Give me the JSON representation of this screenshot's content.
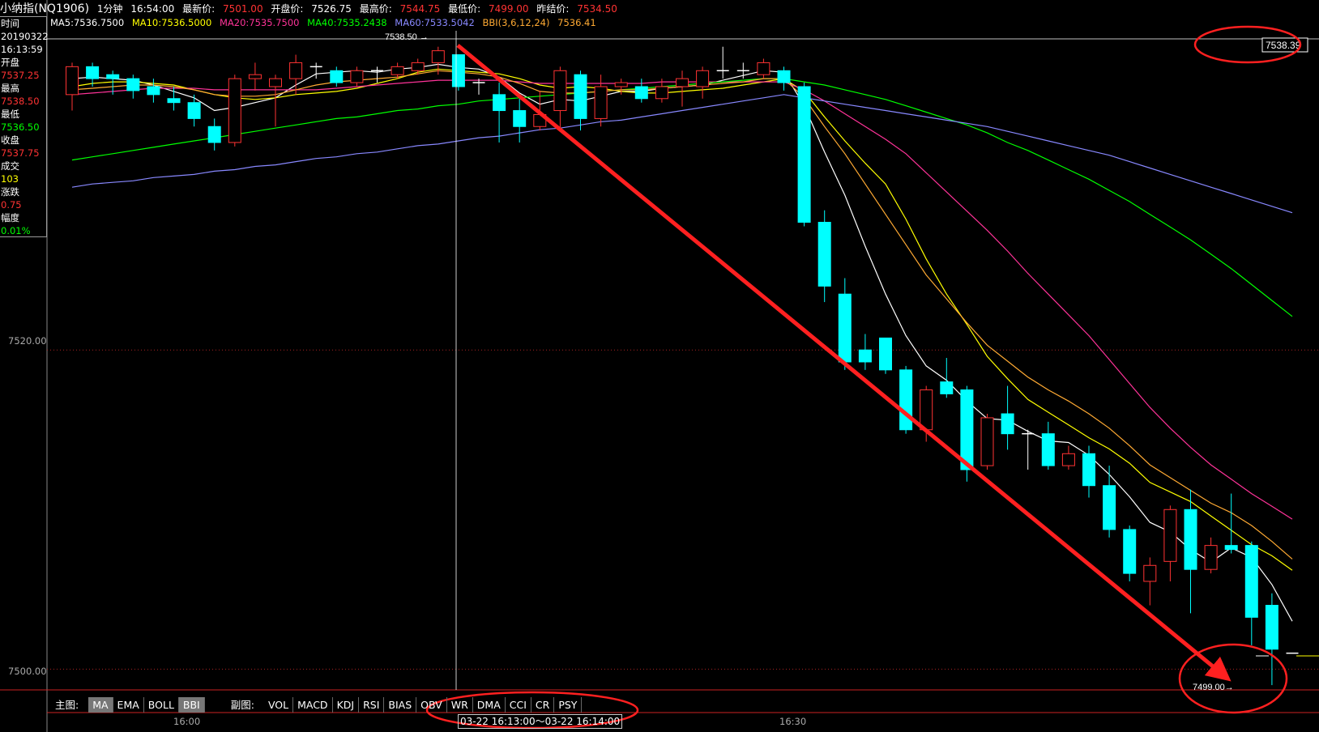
{
  "header": {
    "instrument": "小纳指(NQ1906)",
    "period": "1分钟",
    "time": "16:54:00",
    "latest_label": "最新价:",
    "latest": "7501.00",
    "open_label": "开盘价:",
    "open": "7526.75",
    "high_label": "最高价:",
    "high": "7544.75",
    "low_label": "最低价:",
    "low": "7499.00",
    "prev_close_label": "昨结价:",
    "prev_close": "7534.50"
  },
  "ma_legend": {
    "ma5": "MA5:7536.7500",
    "ma10": "MA10:7536.5000",
    "ma20": "MA20:7535.7500",
    "ma40": "MA40:7535.2438",
    "ma60": "MA60:7533.5042",
    "bbi": "BBI(3,6,12,24)",
    "bbi_val": "7536.41"
  },
  "info_panel": {
    "time_label": "时间",
    "date": "20190322",
    "time": "16:13:59",
    "open_label": "开盘",
    "open": "7537.25",
    "high_label": "最高",
    "high": "7538.50",
    "low_label": "最低",
    "low": "7536.50",
    "close_label": "收盘",
    "close": "7537.75",
    "volume_label": "成交",
    "volume": "103",
    "change_label": "涨跌",
    "change": "0.75",
    "amp_label": "幅度",
    "amp": "0.01%"
  },
  "annotations": {
    "cursor_high": "7538.50",
    "cursor_price": "7538.39",
    "low_mark": "7499.00"
  },
  "tabs": {
    "main_label": "主图:",
    "main": [
      "MA",
      "EMA",
      "BOLL",
      "BBI"
    ],
    "main_active": [
      "MA",
      "BBI"
    ],
    "sub_label": "副图:",
    "sub": [
      "VOL",
      "MACD",
      "KDJ",
      "RSI",
      "BIAS",
      "OBV",
      "WR",
      "DMA",
      "CCI",
      "CR",
      "PSY"
    ]
  },
  "time_axis": {
    "ticks": [
      "16:00",
      "16:30"
    ],
    "range": "03-22 16:13:00〜03-22 16:14:00"
  },
  "colors": {
    "up": "#ff3333",
    "down": "#00ffff",
    "ma5": "#ffffff",
    "ma10": "#ffff00",
    "ma20": "#ff3399",
    "ma40": "#00ff00",
    "ma60": "#8888ff",
    "bbi": "#ffaa33",
    "annotation": "#ff2020"
  },
  "chart_data": {
    "type": "candlestick",
    "y_ticks": [
      "7520.00",
      "7500.00"
    ],
    "ylim": [
      7498.7,
      7540.0
    ],
    "candles": [
      {
        "o": 7536.0,
        "c": 7537.75,
        "h": 7538.0,
        "l": 7535.0
      },
      {
        "o": 7537.75,
        "c": 7537.0,
        "h": 7538.0,
        "l": 7536.5
      },
      {
        "o": 7537.25,
        "c": 7537.0,
        "h": 7537.5,
        "l": 7536.0
      },
      {
        "o": 7537.0,
        "c": 7536.25,
        "h": 7537.25,
        "l": 7535.75
      },
      {
        "o": 7536.5,
        "c": 7536.0,
        "h": 7537.0,
        "l": 7535.5
      },
      {
        "o": 7535.75,
        "c": 7535.5,
        "h": 7536.5,
        "l": 7535.0
      },
      {
        "o": 7535.5,
        "c": 7534.5,
        "h": 7536.0,
        "l": 7534.0
      },
      {
        "o": 7534.0,
        "c": 7533.0,
        "h": 7534.5,
        "l": 7532.5
      },
      {
        "o": 7533.0,
        "c": 7537.0,
        "h": 7537.25,
        "l": 7532.75
      },
      {
        "o": 7537.0,
        "c": 7537.25,
        "h": 7538.0,
        "l": 7536.25
      },
      {
        "o": 7536.5,
        "c": 7537.0,
        "h": 7537.25,
        "l": 7534.0
      },
      {
        "o": 7537.0,
        "c": 7538.0,
        "h": 7538.5,
        "l": 7536.0
      },
      {
        "o": 7537.75,
        "c": 7537.75,
        "h": 7538.0,
        "l": 7537.0
      },
      {
        "o": 7537.5,
        "c": 7536.75,
        "h": 7537.75,
        "l": 7536.5
      },
      {
        "o": 7536.75,
        "c": 7537.5,
        "h": 7537.75,
        "l": 7536.5
      },
      {
        "o": 7537.5,
        "c": 7537.5,
        "h": 7537.75,
        "l": 7536.75
      },
      {
        "o": 7537.25,
        "c": 7537.75,
        "h": 7538.0,
        "l": 7537.0
      },
      {
        "o": 7537.5,
        "c": 7538.0,
        "h": 7538.25,
        "l": 7537.25
      },
      {
        "o": 7538.0,
        "c": 7538.75,
        "h": 7539.0,
        "l": 7537.25
      },
      {
        "o": 7538.5,
        "c": 7536.5,
        "h": 7538.5,
        "l": 7536.25
      },
      {
        "o": 7536.75,
        "c": 7536.75,
        "h": 7537.0,
        "l": 7536.0
      },
      {
        "o": 7536.0,
        "c": 7535.0,
        "h": 7536.75,
        "l": 7533.0
      },
      {
        "o": 7535.0,
        "c": 7534.0,
        "h": 7535.75,
        "l": 7533.0
      },
      {
        "o": 7534.0,
        "c": 7534.75,
        "h": 7536.25,
        "l": 7533.75
      },
      {
        "o": 7535.0,
        "c": 7537.5,
        "h": 7537.75,
        "l": 7533.75
      },
      {
        "o": 7537.25,
        "c": 7534.5,
        "h": 7537.5,
        "l": 7533.75
      },
      {
        "o": 7534.5,
        "c": 7536.5,
        "h": 7537.25,
        "l": 7534.0
      },
      {
        "o": 7536.5,
        "c": 7536.75,
        "h": 7537.0,
        "l": 7536.0
      },
      {
        "o": 7536.5,
        "c": 7535.75,
        "h": 7537.0,
        "l": 7535.5
      },
      {
        "o": 7535.75,
        "c": 7536.5,
        "h": 7537.0,
        "l": 7535.5
      },
      {
        "o": 7536.5,
        "c": 7537.0,
        "h": 7537.5,
        "l": 7535.25
      },
      {
        "o": 7536.5,
        "c": 7537.5,
        "h": 7537.75,
        "l": 7535.75
      },
      {
        "o": 7537.5,
        "c": 7537.5,
        "h": 7539.0,
        "l": 7537.0
      },
      {
        "o": 7537.5,
        "c": 7537.5,
        "h": 7538.0,
        "l": 7537.0
      },
      {
        "o": 7537.25,
        "c": 7538.0,
        "h": 7538.25,
        "l": 7537.0
      },
      {
        "o": 7537.5,
        "c": 7536.75,
        "h": 7537.75,
        "l": 7536.25
      },
      {
        "o": 7536.5,
        "c": 7528.0,
        "h": 7536.75,
        "l": 7527.75
      },
      {
        "o": 7528.0,
        "c": 7524.0,
        "h": 7528.75,
        "l": 7523.0
      },
      {
        "o": 7523.5,
        "c": 7519.25,
        "h": 7524.5,
        "l": 7518.75
      },
      {
        "o": 7520.0,
        "c": 7519.25,
        "h": 7521.0,
        "l": 7518.75
      },
      {
        "o": 7520.75,
        "c": 7518.75,
        "h": 7520.75,
        "l": 7518.5
      },
      {
        "o": 7518.75,
        "c": 7515.0,
        "h": 7519.0,
        "l": 7514.75
      },
      {
        "o": 7515.0,
        "c": 7517.5,
        "h": 7517.75,
        "l": 7514.25
      },
      {
        "o": 7518.0,
        "c": 7517.25,
        "h": 7519.5,
        "l": 7517.0
      },
      {
        "o": 7517.5,
        "c": 7512.5,
        "h": 7517.75,
        "l": 7511.75
      },
      {
        "o": 7512.75,
        "c": 7515.75,
        "h": 7516.0,
        "l": 7512.5
      },
      {
        "o": 7516.0,
        "c": 7514.75,
        "h": 7517.75,
        "l": 7513.75
      },
      {
        "o": 7514.75,
        "c": 7514.75,
        "h": 7515.0,
        "l": 7512.5
      },
      {
        "o": 7514.75,
        "c": 7512.75,
        "h": 7515.5,
        "l": 7512.5
      },
      {
        "o": 7512.75,
        "c": 7513.5,
        "h": 7514.0,
        "l": 7512.5
      },
      {
        "o": 7513.5,
        "c": 7511.5,
        "h": 7514.0,
        "l": 7510.75
      },
      {
        "o": 7511.5,
        "c": 7508.75,
        "h": 7512.75,
        "l": 7508.25
      },
      {
        "o": 7508.75,
        "c": 7506.0,
        "h": 7509.0,
        "l": 7505.5
      },
      {
        "o": 7505.5,
        "c": 7506.5,
        "h": 7507.0,
        "l": 7504.0
      },
      {
        "o": 7506.75,
        "c": 7510.0,
        "h": 7510.25,
        "l": 7505.5
      },
      {
        "o": 7510.0,
        "c": 7506.25,
        "h": 7511.25,
        "l": 7503.5
      },
      {
        "o": 7506.25,
        "c": 7507.75,
        "h": 7508.25,
        "l": 7506.0
      },
      {
        "o": 7507.75,
        "c": 7507.5,
        "h": 7511.0,
        "l": 7507.25
      },
      {
        "o": 7507.75,
        "c": 7503.25,
        "h": 7508.0,
        "l": 7501.5
      },
      {
        "o": 7504.0,
        "c": 7501.25,
        "h": 7504.75,
        "l": 7499.0
      },
      {
        "o": 7501.0,
        "c": 7501.0,
        "h": 7501.0,
        "l": 7501.0
      }
    ],
    "ma_lines": [
      {
        "name": "MA5",
        "values": [
          7537.0,
          7537.1,
          7537.0,
          7536.9,
          7536.6,
          7536.2,
          7535.8,
          7535.0,
          7535.2,
          7535.5,
          7535.8,
          7536.6,
          7537.3,
          7537.4,
          7537.5,
          7537.4,
          7537.6,
          7537.7,
          7537.9,
          7537.7,
          7537.6,
          7537.1,
          7536.1,
          7535.4,
          7535.7,
          7535.6,
          7535.9,
          7536.2,
          7536.2,
          7536.4,
          7536.5,
          7536.6,
          7536.9,
          7537.2,
          7537.5,
          7537.4,
          7535.3,
          7532.4,
          7529.7,
          7526.5,
          7523.5,
          7520.9,
          7519.0,
          7518.1,
          7516.8,
          7515.7,
          7515.6,
          7514.9,
          7514.3,
          7514.2,
          7513.4,
          7512.2,
          7510.8,
          7509.2,
          7508.6,
          7507.5,
          7506.7,
          7507.6,
          7507.0,
          7505.3,
          7503.0
        ]
      },
      {
        "name": "MA10",
        "values": [
          7536.5,
          7536.7,
          7536.8,
          7536.8,
          7536.7,
          7536.6,
          7536.3,
          7536.0,
          7535.8,
          7535.7,
          7535.8,
          7536.0,
          7536.1,
          7536.2,
          7536.4,
          7536.7,
          7537.0,
          7537.4,
          7537.6,
          7537.5,
          7537.4,
          7537.3,
          7537.0,
          7536.6,
          7536.4,
          7536.5,
          7536.4,
          7536.2,
          7536.1,
          7536.1,
          7536.2,
          7536.3,
          7536.4,
          7536.6,
          7536.8,
          7537.0,
          7536.2,
          7534.6,
          7533.1,
          7531.7,
          7530.4,
          7528.2,
          7525.7,
          7523.5,
          7521.6,
          7519.6,
          7518.2,
          7516.9,
          7516.1,
          7515.3,
          7514.5,
          7513.8,
          7512.9,
          7511.7,
          7511.1,
          7510.5,
          7509.6,
          7508.7,
          7507.8,
          7507.1,
          7506.2
        ]
      },
      {
        "name": "MA20",
        "values": [
          7536.0,
          7536.1,
          7536.2,
          7536.3,
          7536.4,
          7536.4,
          7536.4,
          7536.3,
          7536.3,
          7536.3,
          7536.3,
          7536.3,
          7536.3,
          7536.4,
          7536.5,
          7536.6,
          7536.7,
          7536.8,
          7536.9,
          7536.9,
          7536.9,
          7536.9,
          7536.8,
          7536.7,
          7536.7,
          7536.7,
          7536.7,
          7536.7,
          7536.7,
          7536.8,
          7536.8,
          7536.8,
          7536.8,
          7536.8,
          7536.8,
          7536.8,
          7536.3,
          7535.6,
          7534.8,
          7534.0,
          7533.2,
          7532.3,
          7531.1,
          7529.9,
          7528.7,
          7527.5,
          7526.2,
          7524.8,
          7523.5,
          7522.2,
          7520.9,
          7519.4,
          7517.9,
          7516.4,
          7515.1,
          7513.9,
          7512.8,
          7511.9,
          7511.0,
          7510.2,
          7509.4
        ]
      },
      {
        "name": "MA40",
        "values": [
          7531.9,
          7532.1,
          7532.3,
          7532.5,
          7532.7,
          7532.9,
          7533.1,
          7533.3,
          7533.5,
          7533.7,
          7533.9,
          7534.1,
          7534.3,
          7534.5,
          7534.6,
          7534.8,
          7535.0,
          7535.1,
          7535.3,
          7535.4,
          7535.6,
          7535.7,
          7535.8,
          7535.9,
          7536.0,
          7536.1,
          7536.2,
          7536.3,
          7536.4,
          7536.5,
          7536.6,
          7536.7,
          7536.8,
          7536.9,
          7537.0,
          7537.0,
          7536.8,
          7536.6,
          7536.3,
          7536.0,
          7535.7,
          7535.3,
          7534.9,
          7534.5,
          7534.1,
          7533.6,
          7533.0,
          7532.5,
          7531.9,
          7531.3,
          7530.7,
          7530.0,
          7529.3,
          7528.5,
          7527.7,
          7526.9,
          7526.0,
          7525.1,
          7524.1,
          7523.1,
          7522.1
        ]
      },
      {
        "name": "MA60",
        "values": [
          7530.2,
          7530.4,
          7530.5,
          7530.6,
          7530.8,
          7530.9,
          7531.0,
          7531.2,
          7531.3,
          7531.5,
          7531.6,
          7531.8,
          7532.0,
          7532.1,
          7532.3,
          7532.4,
          7532.6,
          7532.8,
          7532.9,
          7533.1,
          7533.3,
          7533.4,
          7533.6,
          7533.8,
          7533.9,
          7534.1,
          7534.3,
          7534.4,
          7534.6,
          7534.8,
          7535.0,
          7535.2,
          7535.4,
          7535.6,
          7535.8,
          7536.0,
          7535.8,
          7535.6,
          7535.4,
          7535.2,
          7535.0,
          7534.8,
          7534.6,
          7534.4,
          7534.2,
          7534.0,
          7533.7,
          7533.4,
          7533.1,
          7532.8,
          7532.5,
          7532.2,
          7531.8,
          7531.4,
          7531.0,
          7530.6,
          7530.2,
          7529.8,
          7529.4,
          7529.0,
          7528.6
        ]
      },
      {
        "name": "BBI",
        "values": [
          7536.3,
          7536.4,
          7536.5,
          7536.6,
          7536.6,
          7536.5,
          7536.3,
          7536.0,
          7535.9,
          7535.9,
          7536.0,
          7536.3,
          7536.6,
          7536.8,
          7536.9,
          7537.0,
          7537.1,
          7537.3,
          7537.5,
          7537.4,
          7537.3,
          7537.1,
          7536.7,
          7536.2,
          7536.1,
          7536.1,
          7536.2,
          7536.3,
          7536.3,
          7536.4,
          7536.5,
          7536.6,
          7536.7,
          7536.8,
          7537.0,
          7537.0,
          7535.8,
          7534.0,
          7532.3,
          7530.4,
          7528.5,
          7526.6,
          7524.7,
          7523.2,
          7521.7,
          7520.3,
          7519.3,
          7518.3,
          7517.5,
          7516.8,
          7516.0,
          7515.1,
          7514.0,
          7512.8,
          7512.0,
          7511.2,
          7510.4,
          7509.8,
          7509.0,
          7508.0,
          7506.9
        ]
      }
    ]
  }
}
